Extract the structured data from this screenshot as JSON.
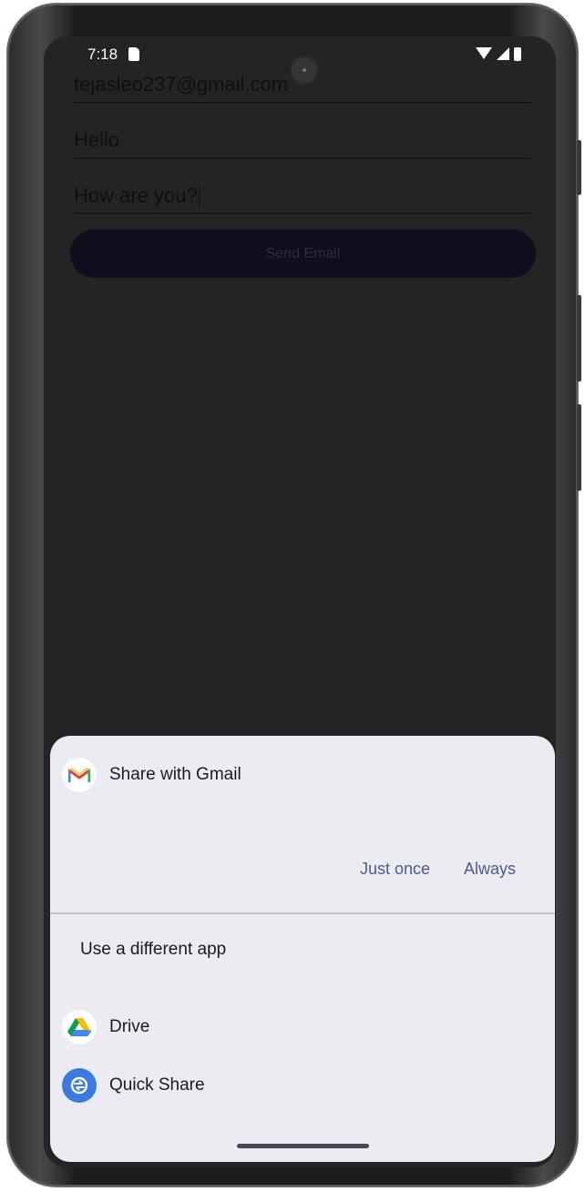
{
  "status_bar": {
    "time": "7:18",
    "icons": [
      "sd-card-icon",
      "wifi-icon",
      "signal-icon",
      "battery-icon"
    ]
  },
  "form": {
    "to_value": "tejasleo237@gmail.com",
    "subject_value": "Hello",
    "message_value": "How are you?",
    "send_button_label": "Send Email"
  },
  "share_sheet": {
    "primary_app": {
      "label": "Share with Gmail",
      "icon": "gmail-icon"
    },
    "actions": {
      "just_once": "Just once",
      "always": "Always"
    },
    "different_app_heading": "Use a different app",
    "apps": [
      {
        "label": "Drive",
        "icon": "google-drive-icon"
      },
      {
        "label": "Quick Share",
        "icon": "quick-share-icon"
      }
    ]
  },
  "colors": {
    "scrim_background": "#242424",
    "sheet_background": "#ecebf2",
    "action_text": "#4a5a92",
    "quick_share_blue": "#3a7be0"
  }
}
